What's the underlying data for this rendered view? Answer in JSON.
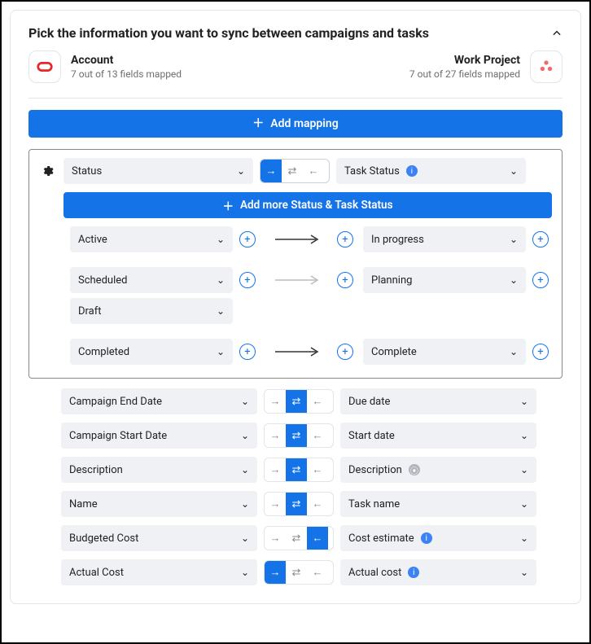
{
  "title": "Pick the information you want to sync between campaigns and tasks",
  "left_app": {
    "name": "Account",
    "subtitle": "7 out of 13 fields mapped"
  },
  "right_app": {
    "name": "Work Project",
    "subtitle": "7 out of 27 fields mapped"
  },
  "add_mapping_label": "Add mapping",
  "status_panel": {
    "left_field": "Status",
    "right_field": "Task Status",
    "add_more": "Add more Status & Task Status",
    "rows": [
      {
        "left": "Active",
        "right": "In progress",
        "dim": false
      },
      {
        "left": "Scheduled",
        "right": "Planning",
        "dim": true,
        "extra_left": "Draft"
      },
      {
        "left": "Completed",
        "right": "Complete",
        "dim": false
      }
    ]
  },
  "mappings": [
    {
      "left": "Campaign End Date",
      "right": "Due date",
      "dir": "both",
      "right_info": null
    },
    {
      "left": "Campaign Start Date",
      "right": "Start date",
      "dir": "both",
      "right_info": null
    },
    {
      "left": "Description",
      "right": "Description",
      "dir": "both",
      "right_info": "gray"
    },
    {
      "left": "Name",
      "right": "Task name",
      "dir": "both",
      "right_info": null
    },
    {
      "left": "Budgeted Cost",
      "right": "Cost estimate",
      "dir": "left",
      "right_info": "blue"
    },
    {
      "left": "Actual Cost",
      "right": "Actual cost",
      "dir": "right",
      "right_info": "blue"
    }
  ]
}
